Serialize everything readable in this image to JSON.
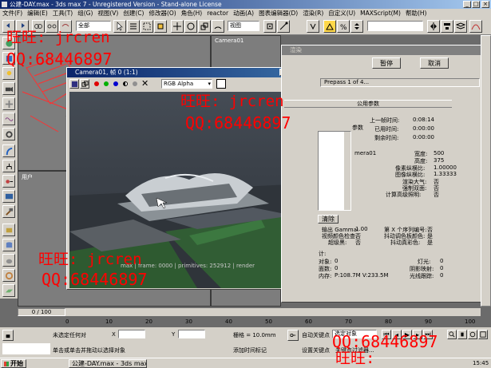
{
  "window": {
    "title": "公建-DAY.max - 3ds max 7 - Unregistered Version - Stand-alone License"
  },
  "menu": [
    "文件(F)",
    "编辑(E)",
    "工具(T)",
    "组(G)",
    "视图(V)",
    "创建(C)",
    "修改器(O)",
    "角色(H)",
    "reactor",
    "动画(A)",
    "图表编辑器(D)",
    "渲染(R)",
    "自定义(U)",
    "MAXScript(M)",
    "帮助(H)"
  ],
  "toolbar": {
    "selection_filter": "全部",
    "view_dropdown": "视图"
  },
  "viewports": {
    "top_left_label": "",
    "camera_label": "Camera01",
    "bottom_left_label": "用户"
  },
  "camera_window": {
    "title": "Camera01, 帧 0 (1:1)",
    "channel": "RGB Alpha",
    "footer": "max | frame: 0000 | primitives: 252912 | render"
  },
  "render_dialog": {
    "title": "渲染",
    "pause_button": "暂停",
    "cancel_button": "取消",
    "progress_text": "Prepass 1 of 4...",
    "section_common": "公用参数",
    "last_time_label": "上一帧时间:",
    "last_time_value": "0:08:14",
    "elapsed_label": "已用时间:",
    "elapsed_value": "0:00:00",
    "remaining_label": "剩余时间:",
    "remaining_value": "0:00:00",
    "params_label": "参数",
    "camera_name": "mera01",
    "width_label": "宽度:",
    "width_value": "500",
    "height_label": "高度:",
    "height_value": "375",
    "pixel_aspect_label": "像素纵横比:",
    "pixel_aspect_value": "1.00000",
    "image_aspect_label": "图像纵横比:",
    "image_aspect_value": "1.33333",
    "render_atmos_label": "渲染大气:",
    "render_atmos_value": "否",
    "force_2side_label": "强制双面:",
    "force_2side_value": "否",
    "subsurface_label": "计算高级照明:",
    "subsurface_value": "否",
    "clear_button": "清除",
    "output_label": "输出 Gamma:",
    "output_value": "1.00",
    "seq_label": "第 X 个序列编号:",
    "seq_value": "否",
    "video_check_label": "视频颜色检查:",
    "video_check_value": "否",
    "antialias_label": "抖动调色板颜色:",
    "antialias_value": "是",
    "super_black_label": "超级黑:",
    "super_black_value": "否",
    "true_color_label": "抖动真彩色:",
    "true_color_value": "是",
    "stats_label": "计:",
    "objects_label": "对象:",
    "objects_value": "0",
    "faces_label": "面数:",
    "faces_value": "0",
    "memory_label": "内存:",
    "memory_value": "P:108.7M V:233.5M",
    "lights_label": "灯光:",
    "lights_value": "0",
    "shadow_label": "阴影映射:",
    "shadow_value": "0",
    "raytrace_label": "光线跟踪:",
    "raytrace_value": "0"
  },
  "timeline": {
    "frame_counter": "0 / 100",
    "ticks": [
      "0",
      "10",
      "20",
      "30",
      "40",
      "50",
      "60",
      "70",
      "80",
      "90",
      "100"
    ]
  },
  "status_bar": {
    "selection": "未选定任何对",
    "hint": "单击或单击并拖动以选择对象",
    "x_label": "X",
    "y_label": "Y",
    "grid_label": "栅格 = 10.0mm",
    "add_time_tag": "添加时间标记",
    "auto_key": "自动关键点",
    "set_key": "设置关键点",
    "selected_dropdown": "选定对象",
    "key_filter": "关键点过滤器..."
  },
  "taskbar": {
    "start": "开始",
    "task": "公建-DAY.max - 3ds max ...",
    "time": "15:45"
  },
  "watermarks": {
    "ww_text": "旺旺: jrcren",
    "qq_text": "QQ:68446897",
    "ww_short": "旺旺:"
  },
  "colors": {
    "watermark": "#ff0000",
    "dialog_bg": "#d4d0c8",
    "title_blue": "#0a246a"
  }
}
